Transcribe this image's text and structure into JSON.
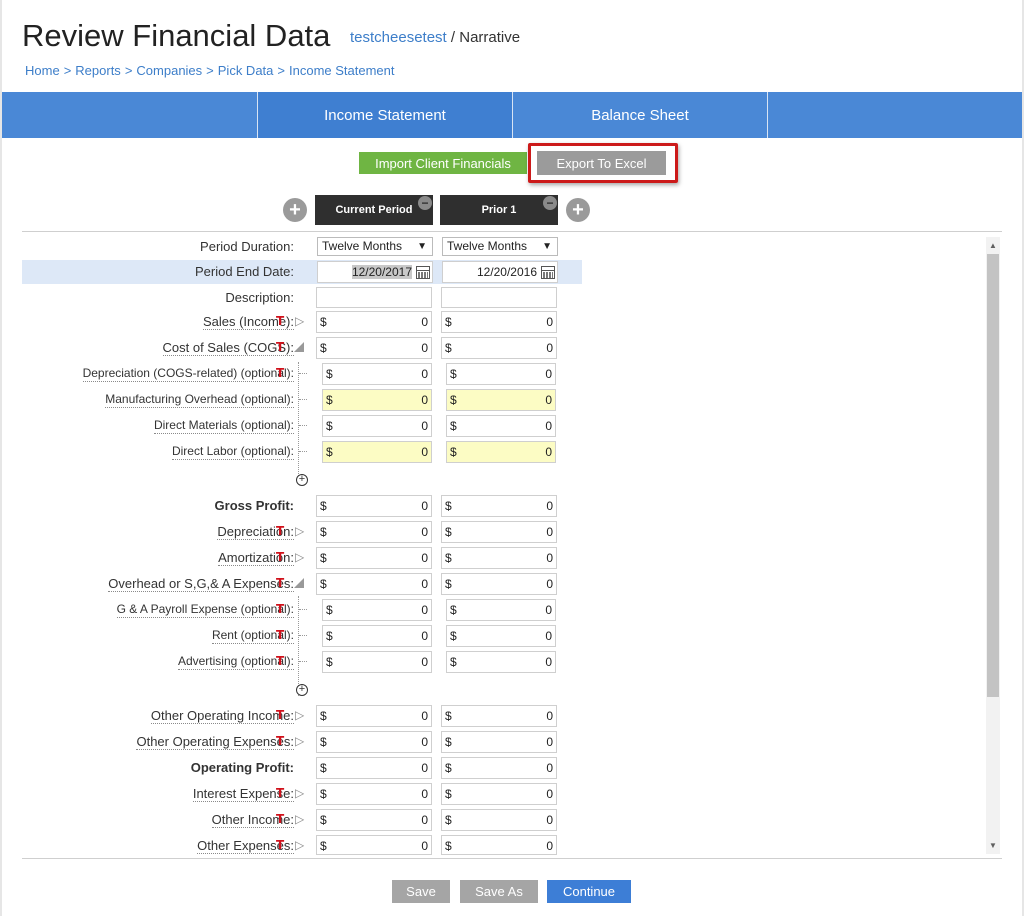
{
  "header": {
    "title": "Review Financial Data",
    "client_name": "testcheesetest",
    "section_suffix": "/ Narrative"
  },
  "breadcrumb": [
    "Home",
    "Reports",
    "Companies",
    "Pick Data",
    "Income Statement"
  ],
  "breadcrumb_separator": ">",
  "tabs": [
    {
      "label": "",
      "active": false
    },
    {
      "label": "Income Statement",
      "active": true
    },
    {
      "label": "Balance Sheet",
      "active": false
    },
    {
      "label": "",
      "active": false
    }
  ],
  "actions": {
    "import_label": "Import Client Financials",
    "export_label": "Export To Excel"
  },
  "columns": [
    {
      "name": "Current Period",
      "duration": "Twelve Months",
      "end_date": "12/20/2017",
      "description": ""
    },
    {
      "name": "Prior 1",
      "duration": "Twelve Months",
      "end_date": "12/20/2016",
      "description": ""
    }
  ],
  "field_labels": {
    "period_duration": "Period Duration:",
    "period_end_date": "Period End Date:",
    "description": "Description:"
  },
  "t_marker": "T",
  "currency_symbol": "$",
  "lines": [
    {
      "label": "Sales (Income):",
      "current": "0",
      "prior": "0"
    },
    {
      "label": "Cost of Sales (COGS):",
      "current": "0",
      "prior": "0"
    },
    {
      "label": "Depreciation (COGS-related) (optional):",
      "current": "0",
      "prior": "0"
    },
    {
      "label": "Manufacturing Overhead (optional):",
      "current": "0",
      "prior": "0"
    },
    {
      "label": "Direct Materials (optional):",
      "current": "0",
      "prior": "0"
    },
    {
      "label": "Direct Labor (optional):",
      "current": "0",
      "prior": "0"
    },
    {
      "label": "Gross Profit:",
      "current": "0",
      "prior": "0"
    },
    {
      "label": "Depreciation:",
      "current": "0",
      "prior": "0"
    },
    {
      "label": "Amortization:",
      "current": "0",
      "prior": "0"
    },
    {
      "label": "Overhead or S,G,& A Expenses:",
      "current": "0",
      "prior": "0"
    },
    {
      "label": "G & A Payroll Expense (optional):",
      "current": "0",
      "prior": "0"
    },
    {
      "label": "Rent (optional):",
      "current": "0",
      "prior": "0"
    },
    {
      "label": "Advertising (optional):",
      "current": "0",
      "prior": "0"
    },
    {
      "label": "Other Operating Income:",
      "current": "0",
      "prior": "0"
    },
    {
      "label": "Other Operating Expenses:",
      "current": "0",
      "prior": "0"
    },
    {
      "label": "Operating Profit:",
      "current": "0",
      "prior": "0"
    },
    {
      "label": "Interest Expense:",
      "current": "0",
      "prior": "0"
    },
    {
      "label": "Other Income:",
      "current": "0",
      "prior": "0"
    },
    {
      "label": "Other Expenses:",
      "current": "0",
      "prior": "0"
    }
  ],
  "footer": {
    "save_label": "Save",
    "save_as_label": "Save As",
    "continue_label": "Continue"
  },
  "colors": {
    "tab_bar": "#4a88d6",
    "import_button": "#6fb543",
    "export_button": "#9b9b9b",
    "highlight_box": "#cc1a1a",
    "continue_button": "#3d7ed6",
    "t_marker": "#d0111b",
    "yellow_field": "#fcfcc4"
  }
}
